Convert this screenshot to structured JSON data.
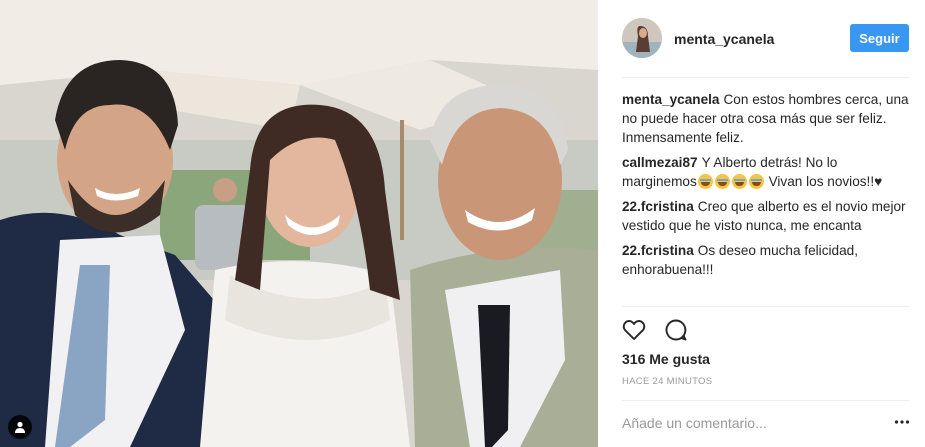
{
  "post": {
    "username": "menta_ycanela",
    "follow_label": "Seguir",
    "likes_text": "316 Me gusta",
    "time_text": "HACE 24 MINUTOS",
    "comment_placeholder": "Añade un comentario...",
    "comments": [
      {
        "author": "menta_ycanela",
        "text": "Con estos hombres cerca, una no puede hacer otra cosa más que ser feliz. Inmensamente feliz."
      },
      {
        "author": "callmezai87",
        "text_before_emoji": "Y Alberto detrás! No lo marginemos",
        "emoji_count": 4,
        "text_after_emoji": " Vivan los novios!!",
        "trailing_symbol": "♥"
      },
      {
        "author": "22.fcristina",
        "text": "Creo que alberto es el novio mejor vestido que he visto nunca, me encanta"
      },
      {
        "author": "22.fcristina",
        "text": "Os deseo mucha felicidad, enhorabuena!!!"
      }
    ]
  },
  "icons": {
    "tag": "person-tag-icon",
    "like": "heart-icon",
    "comment": "comment-bubble-icon",
    "more": "more-options-icon"
  },
  "colors": {
    "accent": "#3897f0",
    "text": "#262626",
    "muted": "#999999",
    "divider": "#efefef"
  }
}
